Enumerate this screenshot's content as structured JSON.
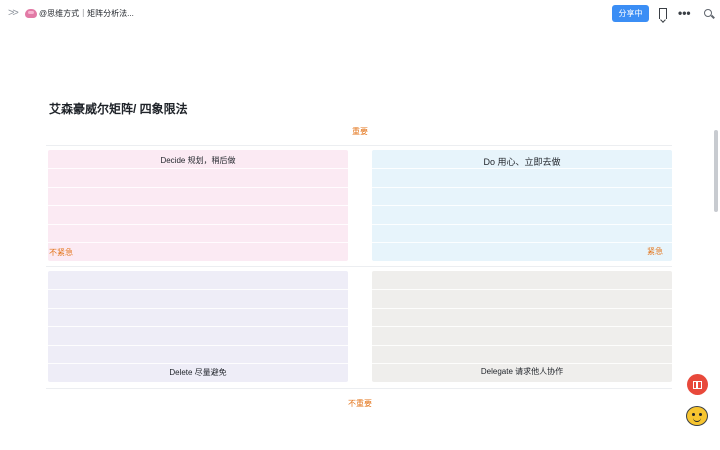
{
  "topbar": {
    "doc_title": "@思维方式｜矩阵分析法...",
    "share_label": "分享中",
    "more_glyph": "•••"
  },
  "doc": {
    "title": "艾森豪威尔矩阵/ 四象限法",
    "important_label": "重要",
    "unimportant_label": "不重要",
    "not_urgent_label": "不紧急",
    "urgent_label": "紧急",
    "quadrants": {
      "decide": "Decide 规划，稍后做",
      "do": "Do  用心、立即去做",
      "delete": "Delete  尽量避免",
      "delegate": "Delegate 请求他人协作"
    }
  },
  "colors": {
    "accent": "#3b8ef5",
    "label_orange": "#e37318",
    "decide_bg": "#fbeaf3",
    "do_bg": "#e7f4fb",
    "delete_bg": "#eeedf7",
    "delegate_bg": "#efeeec"
  },
  "icons": [
    "expand-icon",
    "brain-emoji-icon",
    "bookmark-icon",
    "more-icon",
    "search-icon",
    "gift-icon",
    "assistant-icon"
  ]
}
